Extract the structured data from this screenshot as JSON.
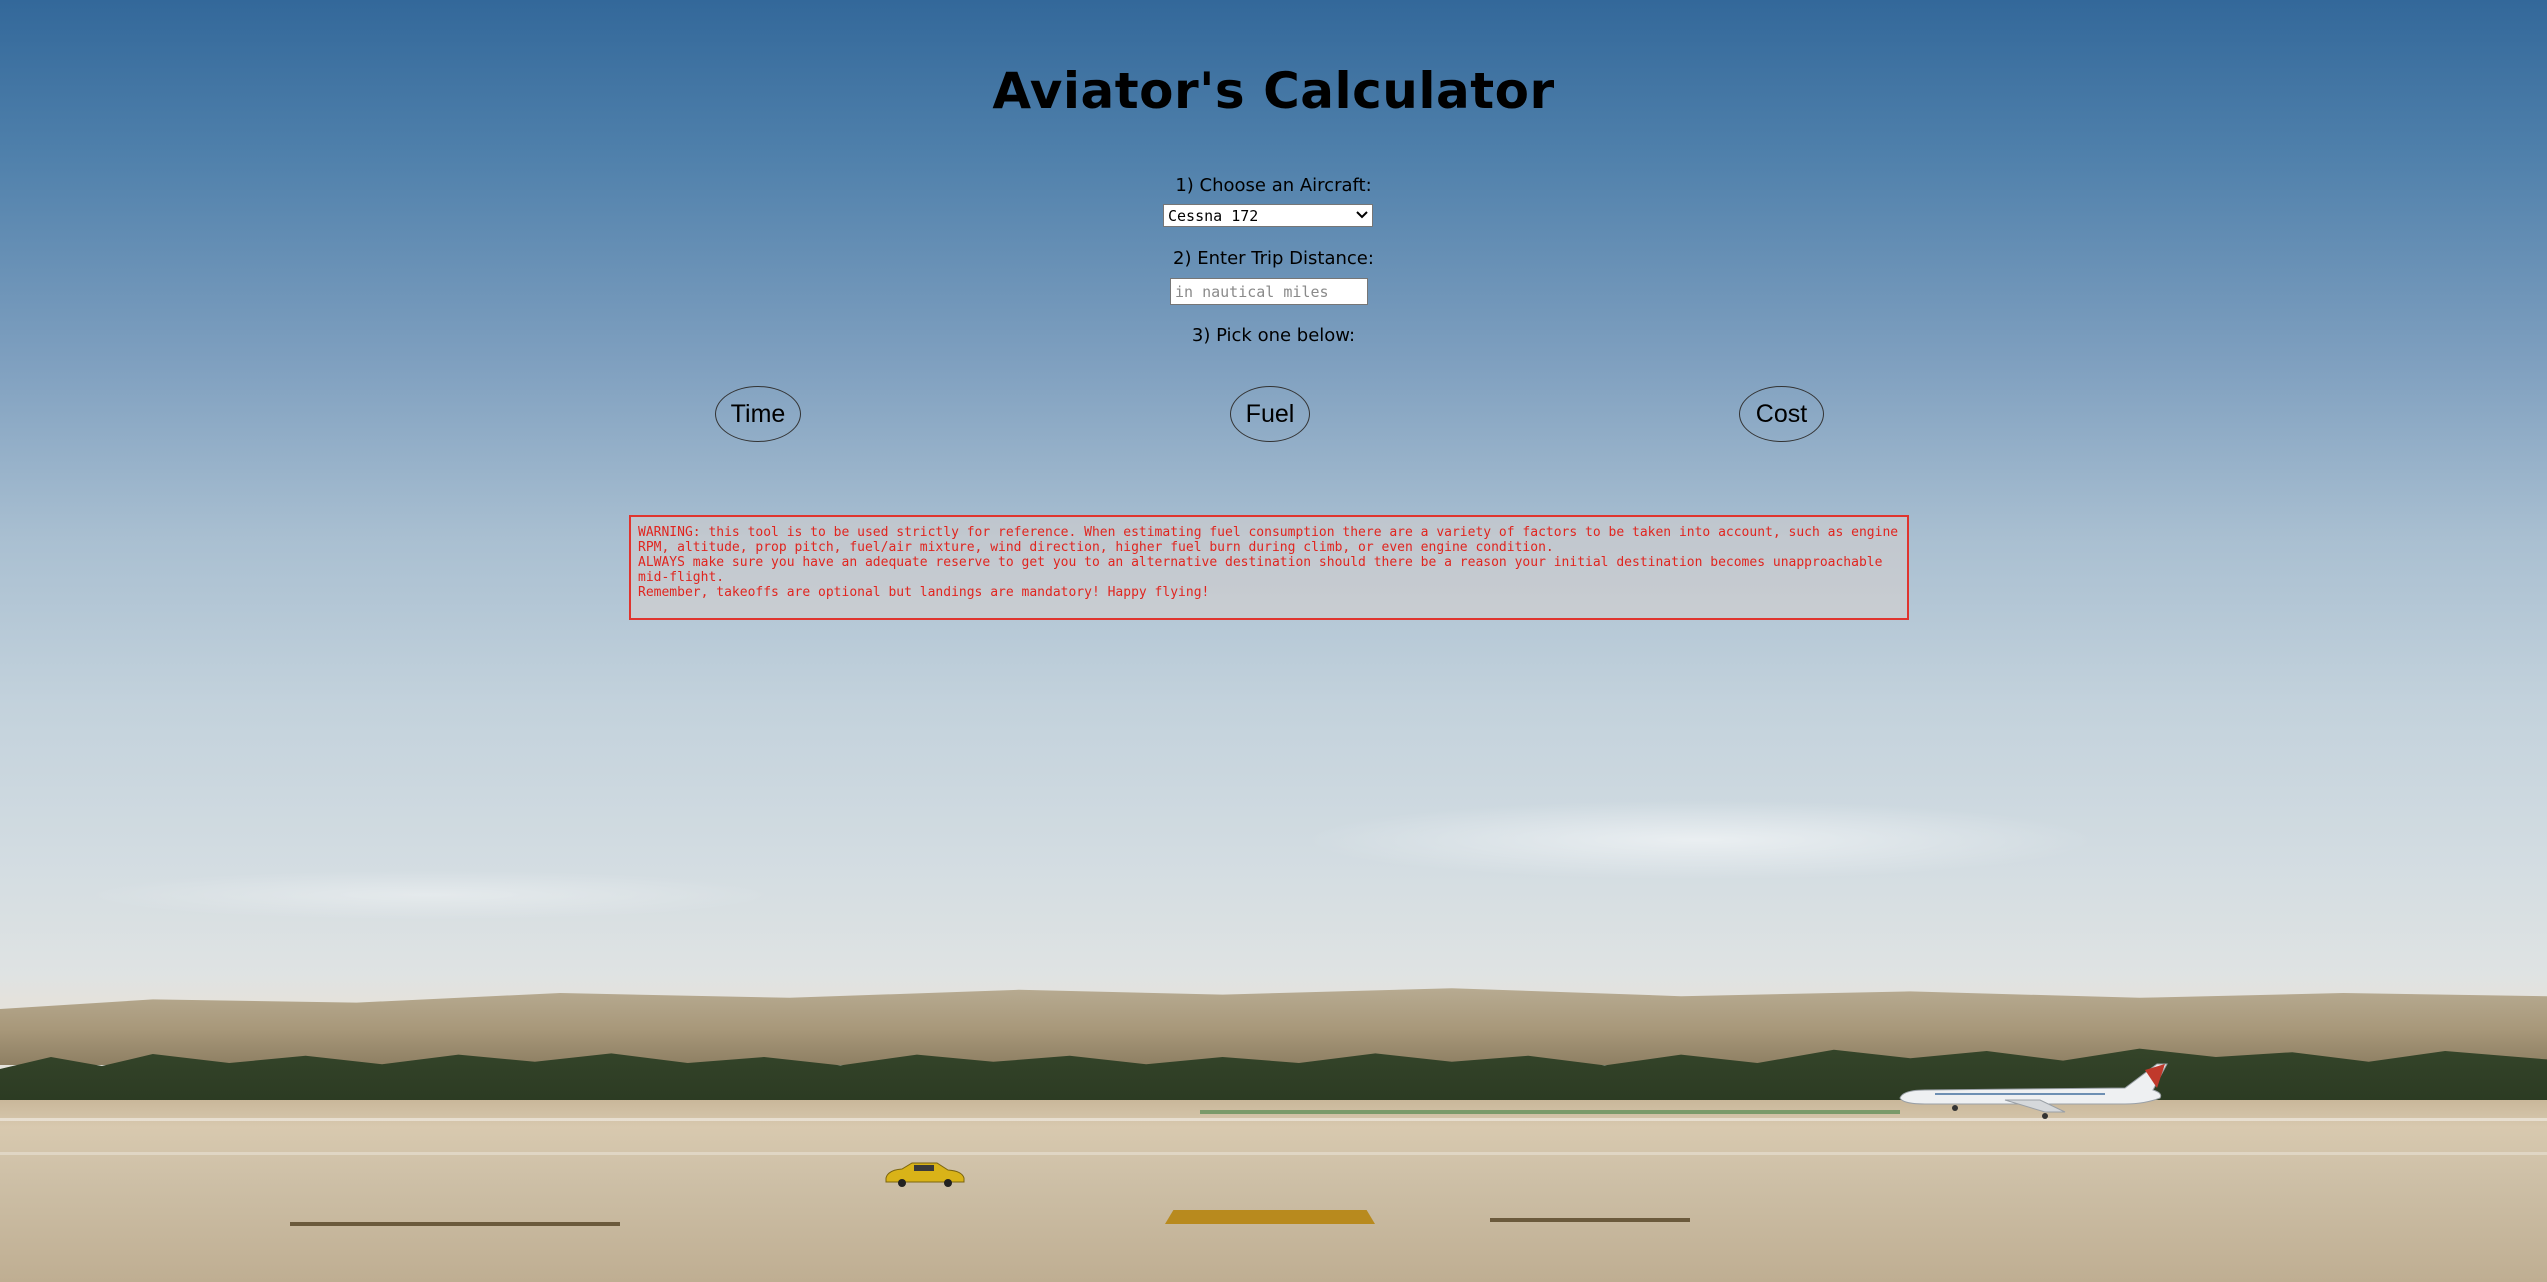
{
  "page": {
    "title": "Aviator's Calculator"
  },
  "steps": {
    "aircraft_label": "1) Choose an Aircraft:",
    "aircraft_selected": "Cessna 172",
    "distance_label": "2) Enter Trip Distance:",
    "distance_value": "",
    "distance_placeholder": "in nautical miles",
    "pick_label": "3) Pick one below:"
  },
  "buttons": {
    "time": "Time",
    "fuel": "Fuel",
    "cost": "Cost"
  },
  "warning": {
    "line1": "WARNING: this tool is to be used strictly for reference. When estimating fuel consumption there are a variety of factors to be taken into account, such as engine RPM, altitude, prop pitch, fuel/air mixture, wind direction, higher fuel burn during climb, or even engine condition.",
    "line2": "ALWAYS make sure you have an adequate reserve to get you to an alternative destination should there be a reason your initial destination becomes unapproachable mid-flight.",
    "line3": "Remember, takeoffs are optional but landings are mandatory! Happy flying!"
  },
  "colors": {
    "warning_text": "#e0251f",
    "warning_border": "#e0342e"
  },
  "icons": {
    "select_arrow": "chevron-down-icon",
    "background": "airport-runway-background"
  }
}
